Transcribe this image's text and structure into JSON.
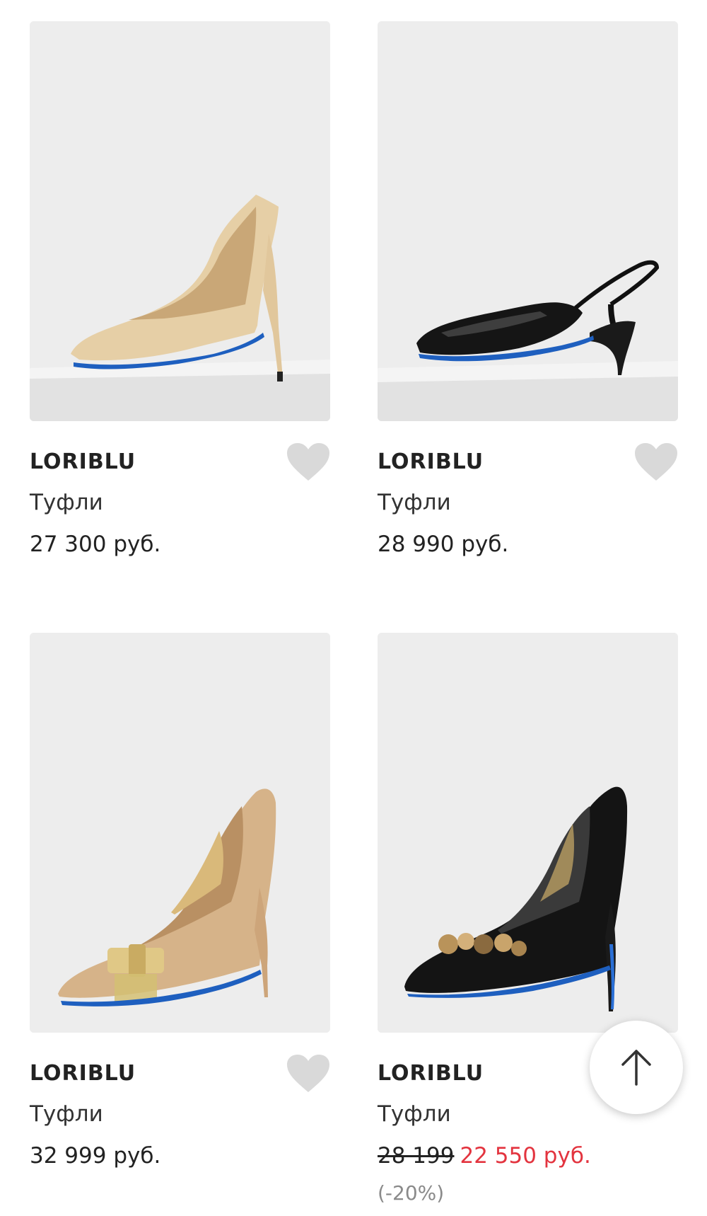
{
  "products": [
    {
      "brand": "LORIBLU",
      "category": "Туфли",
      "price": "27 300 руб.",
      "image_icon": "beige-suede-pump-image",
      "favorite_icon": "heart-icon"
    },
    {
      "brand": "LORIBLU",
      "category": "Туфли",
      "price": "28 990 руб.",
      "image_icon": "black-patent-slingback-image",
      "favorite_icon": "heart-icon"
    },
    {
      "brand": "LORIBLU",
      "category": "Туфли",
      "price": "32 999 руб.",
      "image_icon": "nude-leather-bow-pump-image",
      "favorite_icon": "heart-icon"
    },
    {
      "brand": "LORIBLU",
      "category": "Туфли",
      "old_price": "28 199",
      "new_price": "22 550 руб.",
      "discount": "(-20%)",
      "image_icon": "black-suede-embellished-pump-image"
    }
  ],
  "scroll_top": {
    "icon": "arrow-up-icon"
  },
  "colors": {
    "sale_price": "#e3343f",
    "photo_background": "#ececec",
    "heart": "#d9d9d9",
    "text": "#222222",
    "muted": "#8a8a8a"
  }
}
